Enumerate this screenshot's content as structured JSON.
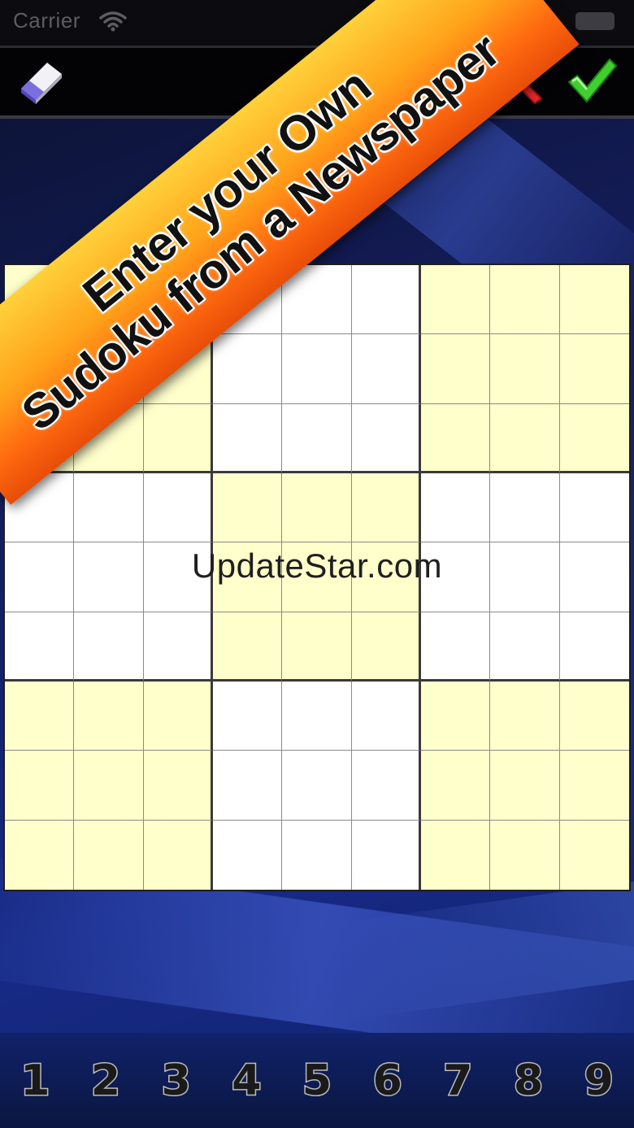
{
  "status_bar": {
    "carrier": "Carrier"
  },
  "toolbar": {
    "eraser_icon": "eraser-icon",
    "cancel_icon": "red-x-icon",
    "accept_icon": "green-check-icon"
  },
  "banner": {
    "line1": "Enter your Own",
    "line2": "Sudoku from a Newspaper",
    "colors": {
      "top": "#ffd13a",
      "bottom": "#e84d08"
    }
  },
  "watermark": "UpdateStar.com",
  "grid": {
    "size": 9,
    "box_size": 3,
    "shaded_color": "#ffffcc",
    "plain_color": "#ffffff"
  },
  "numpad": {
    "keys": [
      "1",
      "2",
      "3",
      "4",
      "5",
      "6",
      "7",
      "8",
      "9"
    ]
  }
}
